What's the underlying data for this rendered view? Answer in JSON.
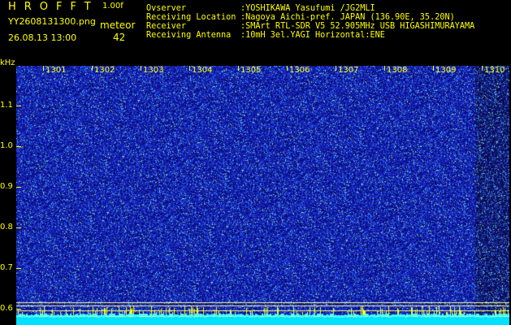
{
  "header": {
    "logo": "HROFFT",
    "version": "1.00f",
    "filename": "YY2608131300.png",
    "timestamp": "26.08.13 13:00",
    "meteor_label": "meteor",
    "meteor_count": "42"
  },
  "info": [
    {
      "label": "Ovserver",
      "value": ":YOSHIKAWA Yasufumi /JG2MLI"
    },
    {
      "label": "Receiving Location",
      "value": ":Nagoya Aichi-pref. JAPAN (136.90E, 35.20N)"
    },
    {
      "label": "Receiver",
      "value": ":SMArt RTL-SDR V5 52.905MHz USB HIGASHIMURAYAMA"
    },
    {
      "label": "Receiving Antenna",
      "value": ":10mH 3el.YAGI Horizontal:ENE"
    }
  ],
  "axis": {
    "y_unit": "kHz",
    "x_ticks": [
      "1301",
      "1302",
      "1303",
      "1304",
      "1305",
      "1306",
      "1307",
      "1308",
      "1309",
      "1310"
    ],
    "y_ticks": [
      "1.1",
      "1.0",
      "0.9",
      "0.8",
      "0.7",
      "0.6"
    ]
  },
  "colors": {
    "background": "#000000",
    "text": "#ffff00",
    "noise_base": "#1d2fb8",
    "guide_line": "#ffff7f",
    "baseline": "#00e0ff"
  }
}
